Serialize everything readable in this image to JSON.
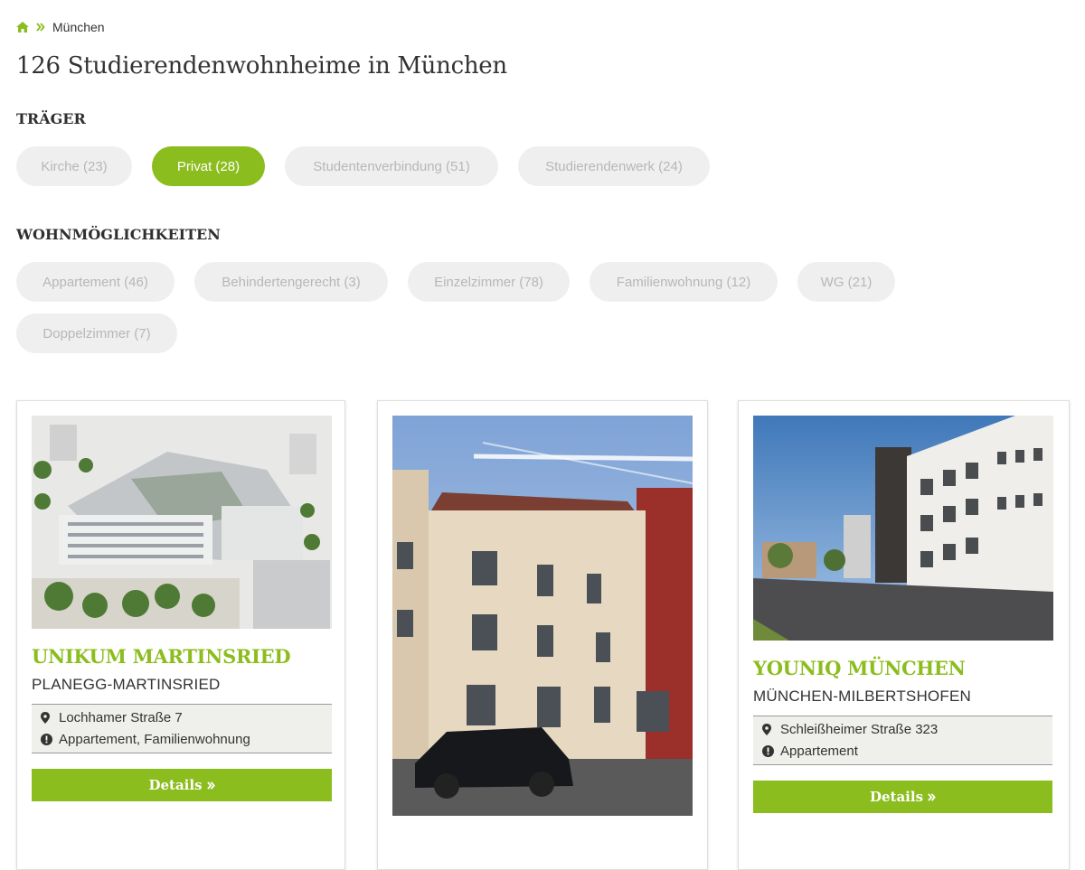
{
  "breadcrumb": {
    "home_icon": "home-icon",
    "current": "München"
  },
  "page": {
    "title": "126 Studierendenwohnheime in München"
  },
  "traeger": {
    "title": "TRÄGER",
    "options": [
      {
        "label": "Kirche (23)",
        "active": false
      },
      {
        "label": "Privat (28)",
        "active": true
      },
      {
        "label": "Studentenverbindung (51)",
        "active": false
      },
      {
        "label": "Studierendenwerk (24)",
        "active": false
      }
    ]
  },
  "wohnmoeglichkeiten": {
    "title": "WOHNMÖGLICHKEITEN",
    "options": [
      {
        "label": "Appartement (46)"
      },
      {
        "label": "Behindertengerecht (3)"
      },
      {
        "label": "Einzelzimmer (78)"
      },
      {
        "label": "Familienwohnung (12)"
      },
      {
        "label": "WG (21)"
      },
      {
        "label": "Doppelzimmer (7)"
      }
    ]
  },
  "cards": [
    {
      "name": "UNIKUM MARTINSRIED",
      "district": "PLANEGG-MARTINSRIED",
      "address": "Lochhamer Straße 7",
      "types": "Appartement, Familienwohnung",
      "details": "Details"
    },
    {
      "name": "",
      "district": "",
      "address": "",
      "types": "",
      "details": ""
    },
    {
      "name": "YOUNIQ MÜNCHEN",
      "district": "MÜNCHEN-MILBERTSHOFEN",
      "address": "Schleißheimer Straße 323",
      "types": "Appartement",
      "details": "Details"
    }
  ],
  "colors": {
    "accent": "#8cbd1e",
    "chip_bg": "#efefef",
    "chip_text": "#b7b7b7"
  }
}
